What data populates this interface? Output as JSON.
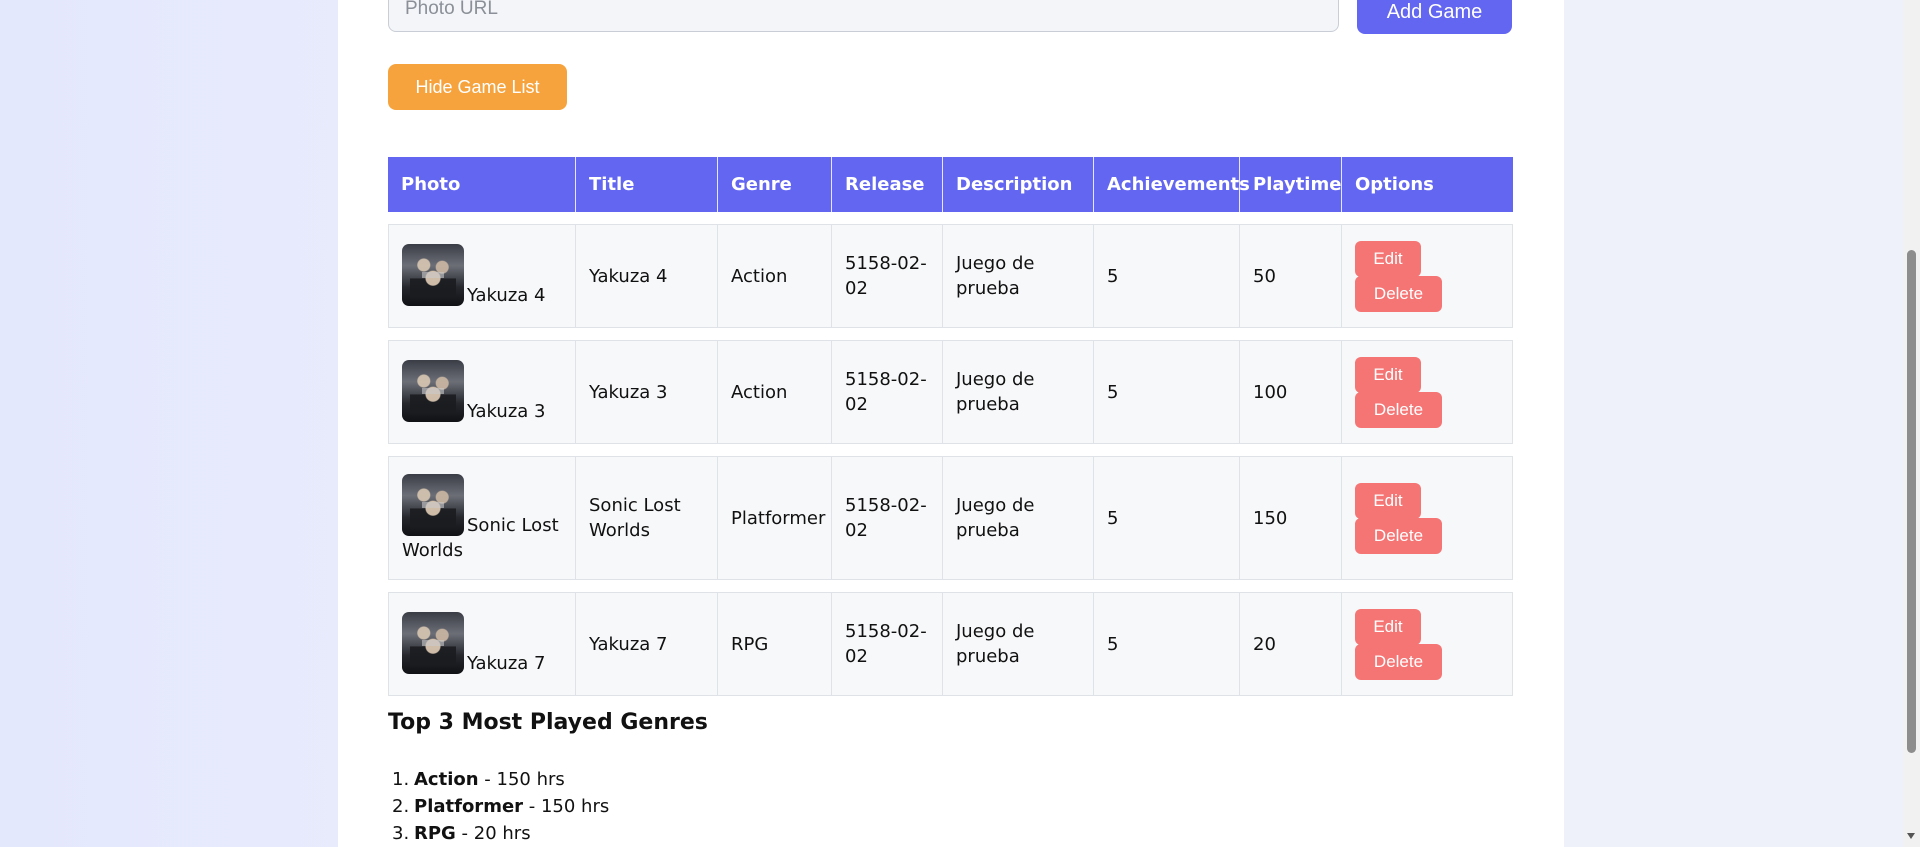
{
  "form": {
    "photo_placeholder": "Photo URL",
    "add_button": "Add Game",
    "toggle_button": "Hide Game List"
  },
  "table": {
    "headers": [
      "Photo",
      "Title",
      "Genre",
      "Release",
      "Description",
      "Achievements",
      "Playtime",
      "Options"
    ],
    "rows": [
      {
        "photo_caption": "Yakuza 4",
        "title": "Yakuza 4",
        "genre": "Action",
        "release": "5158-02-02",
        "description": "Juego de prueba",
        "achievements": "5",
        "playtime": "50"
      },
      {
        "photo_caption": "Yakuza 3",
        "title": "Yakuza 3",
        "genre": "Action",
        "release": "5158-02-02",
        "description": "Juego de prueba",
        "achievements": "5",
        "playtime": "100"
      },
      {
        "photo_caption": "Sonic Lost Worlds",
        "title": "Sonic Lost Worlds",
        "genre": "Platformer",
        "release": "5158-02-02",
        "description": "Juego de prueba",
        "achievements": "5",
        "playtime": "150"
      },
      {
        "photo_caption": "Yakuza 7",
        "title": "Yakuza 7",
        "genre": "RPG",
        "release": "5158-02-02",
        "description": "Juego de prueba",
        "achievements": "5",
        "playtime": "20"
      }
    ],
    "edit_label": "Edit",
    "delete_label": "Delete"
  },
  "genres": {
    "title": "Top 3 Most Played Genres",
    "items": [
      {
        "rank": "1.",
        "name": "Action",
        "hours": " - 150 hrs"
      },
      {
        "rank": "2.",
        "name": "Platformer",
        "hours": " - 150 hrs"
      },
      {
        "rank": "3.",
        "name": "RPG",
        "hours": " - 20 hrs"
      }
    ]
  },
  "colors": {
    "accent": "#6366f1",
    "toggle": "#f6a33e",
    "danger": "#f57575"
  },
  "icons": {
    "thumbnail": "game-cover-image"
  }
}
